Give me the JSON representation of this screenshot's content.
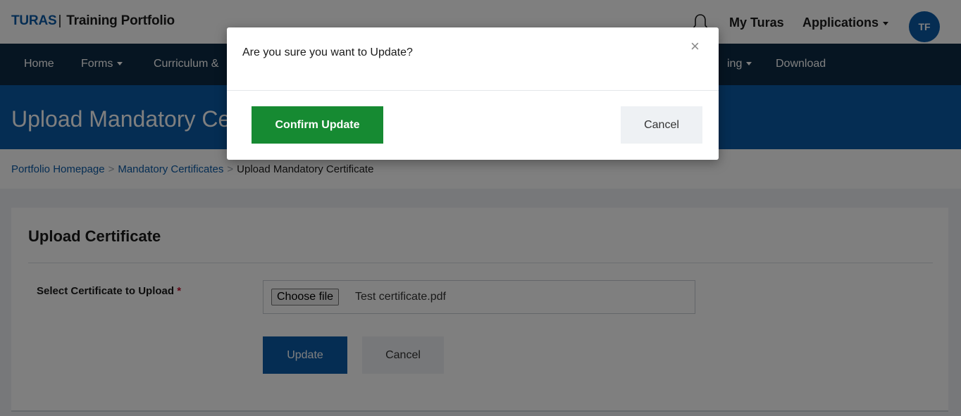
{
  "header": {
    "brand_main": "TURAS",
    "brand_separator": "|",
    "brand_sub": "Training Portfolio",
    "my_turas": "My Turas",
    "applications": "Applications",
    "avatar_initials": "TF",
    "bell_icon": "bell-icon"
  },
  "nav": {
    "items": [
      {
        "label": "Home"
      },
      {
        "label": "Forms"
      },
      {
        "label": "Curriculum &"
      },
      {
        "label": "ing"
      },
      {
        "label": "Download"
      }
    ]
  },
  "hero": {
    "title": "Upload Mandatory Ce"
  },
  "breadcrumb": {
    "items": [
      "Portfolio Homepage",
      "Mandatory Certificates",
      "Upload Mandatory Certificate"
    ],
    "separator": ">"
  },
  "form": {
    "title": "Upload Certificate",
    "label": "Select Certificate to Upload",
    "required_marker": "*",
    "choose_file": "Choose file",
    "file_name": "Test certificate.pdf",
    "update_label": "Update",
    "cancel_label": "Cancel"
  },
  "modal": {
    "question": "Are you sure you want to Update?",
    "close_glyph": "×",
    "confirm_label": "Confirm Update",
    "cancel_label": "Cancel"
  },
  "colors": {
    "brand_blue": "#0b5aa7",
    "navbar": "#0d2a45",
    "confirm_green": "#168a32",
    "required_red": "#c8102e"
  }
}
